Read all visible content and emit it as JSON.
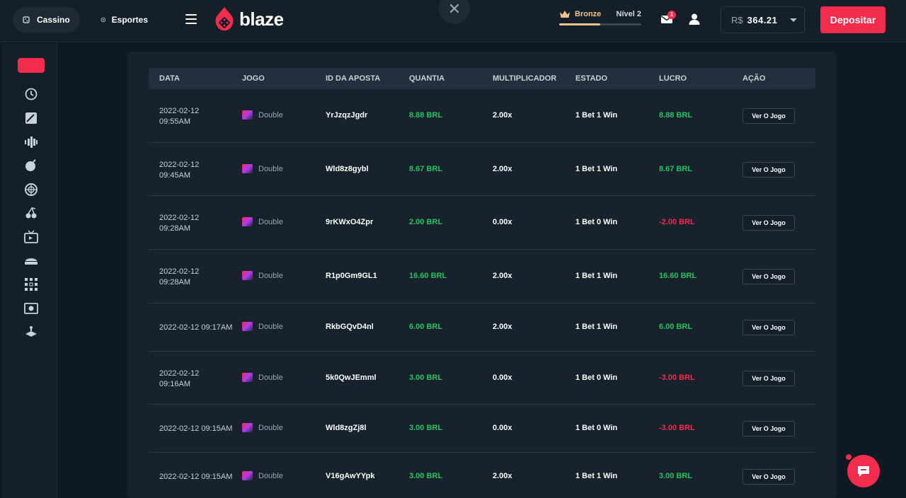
{
  "header": {
    "tabs": [
      {
        "label": "Cassino",
        "icon": "dice-icon"
      },
      {
        "label": "Esportes",
        "icon": "ball-icon"
      }
    ],
    "logo_text": "blaze",
    "rank": {
      "name": "Bronze",
      "level": "Nível 2",
      "progress_fraction": 0.5
    },
    "mail_badge": "1",
    "balance": {
      "currency": "R$",
      "value": "364.21"
    },
    "deposit_label": "Depositar",
    "close_symbol": "✕"
  },
  "colors": {
    "accent": "#f12c4c",
    "positive": "#22c55e",
    "negative": "#f12c4c",
    "rank": "#f0c38a",
    "background": "#0f1923"
  },
  "sidebar": {
    "icons": [
      "home-icon",
      "history-icon",
      "crash-icon",
      "double-icon",
      "mines-icon",
      "roulette-icon",
      "slots-icon",
      "tv-icon",
      "blackjack-icon",
      "dice-grid-icon",
      "money-icon",
      "tower-icon"
    ]
  },
  "table": {
    "headers": [
      "DATA",
      "JOGO",
      "ID DA APOSTA",
      "QUANTIA",
      "MULTIPLICADOR",
      "ESTADO",
      "LUCRO",
      "AÇÃO"
    ],
    "rows": [
      {
        "date": "2022-02-12 09:55AM",
        "game": "Double",
        "id": "YrJzqzJgdr",
        "amount": "8.88 BRL",
        "multiplier": "2.00x",
        "state": "1 Bet 1 Win",
        "profit": "8.88 BRL",
        "positive": true,
        "action": "Ver O Jogo"
      },
      {
        "date": "2022-02-12 09:45AM",
        "game": "Double",
        "id": "Wld8z8gybl",
        "amount": "8.67 BRL",
        "multiplier": "2.00x",
        "state": "1 Bet 1 Win",
        "profit": "8.67 BRL",
        "positive": true,
        "action": "Ver O Jogo"
      },
      {
        "date": "2022-02-12 09:28AM",
        "game": "Double",
        "id": "9rKWxO4Zpr",
        "amount": "2.00 BRL",
        "multiplier": "0.00x",
        "state": "1 Bet 0 Win",
        "profit": "-2.00 BRL",
        "positive": false,
        "action": "Ver O Jogo"
      },
      {
        "date": "2022-02-12 09:28AM",
        "game": "Double",
        "id": "R1p0Gm9GL1",
        "amount": "16.60 BRL",
        "multiplier": "2.00x",
        "state": "1 Bet 1 Win",
        "profit": "16.60 BRL",
        "positive": true,
        "action": "Ver O Jogo"
      },
      {
        "date": "2022-02-12 09:17AM",
        "game": "Double",
        "id": "RkbGQvD4nl",
        "amount": "6.00 BRL",
        "multiplier": "2.00x",
        "state": "1 Bet 1 Win",
        "profit": "6.00 BRL",
        "positive": true,
        "action": "Ver O Jogo"
      },
      {
        "date": "2022-02-12 09:16AM",
        "game": "Double",
        "id": "5k0QwJEmml",
        "amount": "3.00 BRL",
        "multiplier": "0.00x",
        "state": "1 Bet 0 Win",
        "profit": "-3.00 BRL",
        "positive": false,
        "action": "Ver O Jogo"
      },
      {
        "date": "2022-02-12 09:15AM",
        "game": "Double",
        "id": "Wld8zgZj8l",
        "amount": "3.00 BRL",
        "multiplier": "0.00x",
        "state": "1 Bet 0 Win",
        "profit": "-3.00 BRL",
        "positive": false,
        "action": "Ver O Jogo"
      },
      {
        "date": "2022-02-12 09:15AM",
        "game": "Double",
        "id": "V16gAwYYpk",
        "amount": "3.00 BRL",
        "multiplier": "2.00x",
        "state": "1 Bet 1 Win",
        "profit": "3.00 BRL",
        "positive": true,
        "action": "Ver O Jogo"
      }
    ]
  }
}
